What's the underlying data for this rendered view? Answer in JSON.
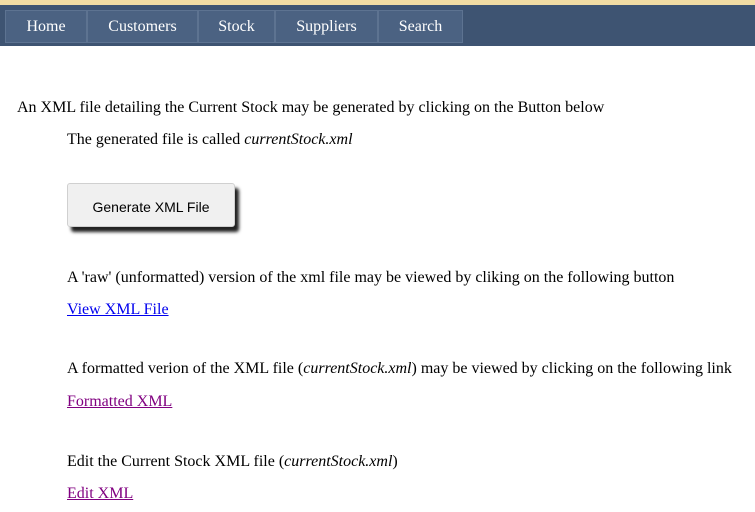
{
  "nav": {
    "home": "Home",
    "customers": "Customers",
    "stock": "Stock",
    "suppliers": "Suppliers",
    "search": "Search"
  },
  "content": {
    "intro": "An XML file detailing the Current Stock may be generated by clicking on the Button below",
    "generated_prefix": "The generated file is called ",
    "filename": "currentStock.xml",
    "generate_button": "Generate XML File",
    "raw_text": "A 'raw' (unformatted) version of the xml file may be viewed by cliking on the following button",
    "view_link": "View XML File",
    "formatted_prefix": "A formatted verion of the XML file (",
    "formatted_suffix": ") may be viewed by clicking on the following link",
    "formatted_link": "Formatted XML",
    "edit_prefix": "Edit the Current Stock XML file (",
    "edit_suffix": ")",
    "edit_link": "Edit XML"
  },
  "colors": {
    "navbar": "#3e5472",
    "nav_item": "#4b6282",
    "top_stripe": "#f1dca4",
    "link_unvisited": "#0000ee",
    "link_visited": "#800080"
  }
}
